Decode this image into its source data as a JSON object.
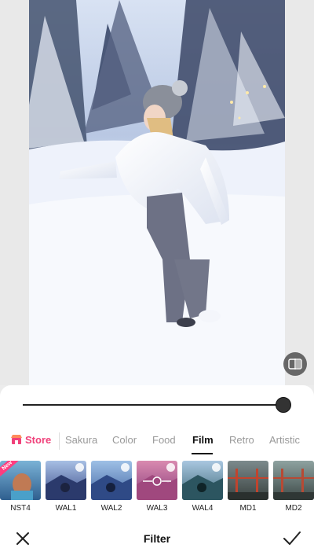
{
  "photo": {
    "description_icon": "photo-of-woman-in-snow"
  },
  "compare": {
    "icon": "compare-icon"
  },
  "slider": {
    "value": 1.0
  },
  "tabs": {
    "store_label": "Store",
    "items": [
      {
        "label": "Sakura"
      },
      {
        "label": "Color"
      },
      {
        "label": "Food"
      },
      {
        "label": "Film"
      },
      {
        "label": "Retro"
      },
      {
        "label": "Artistic"
      }
    ],
    "active": "Film"
  },
  "filters": [
    {
      "label": "NST4",
      "badge": "New"
    },
    {
      "label": "WAL1"
    },
    {
      "label": "WAL2"
    },
    {
      "label": "WAL3"
    },
    {
      "label": "WAL4"
    },
    {
      "label": "MD1"
    },
    {
      "label": "MD2"
    }
  ],
  "bottom_bar": {
    "title": "Filter"
  },
  "colors": {
    "accent": "#f0407a",
    "active_tab": "#111111"
  }
}
